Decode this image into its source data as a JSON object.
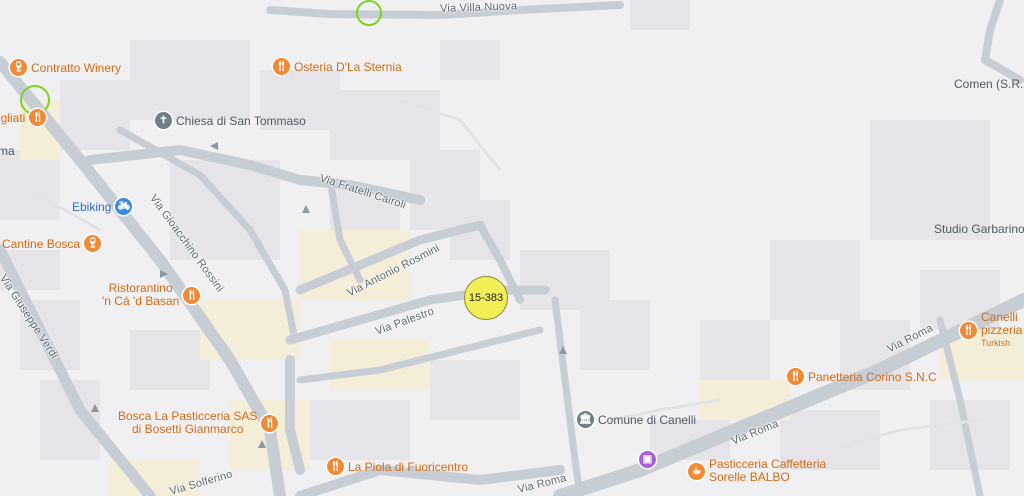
{
  "map": {
    "marker": {
      "label": "15-383"
    },
    "streets": {
      "via_villa_nuova": "Via Villa Nuova",
      "via_fratelli_cairoli": "Via Fratelli Cairoli",
      "via_gioacchino_rossini": "Via Gioacchino Rossini",
      "via_antonio_rosmini": "Via Antonio Rosmini",
      "via_palestro": "Via Palestro",
      "via_giuseppe_verdi": "Via Giuseppe Verdi",
      "via_roma_east": "Via Roma",
      "via_roma_center": "Via Roma",
      "via_roma_south": "Via Roma",
      "via_solferino": "Via Solferino"
    },
    "pois": {
      "contratto": "Contratto Winery",
      "osteria": "Osteria D'La Sternia",
      "chiesa": "Chiesa di San Tommaso",
      "figliati": "igliati",
      "ebiking": "Ebiking",
      "cantine_bosca": "Cantine Bosca",
      "ristorantino_1": "Ristorantino",
      "ristorantino_2": "'n Cá 'd Basan",
      "bosca_pasticceria_1": "Bosca La Pasticceria SAS",
      "bosca_pasticceria_2": "di Bosetti Gianmarco",
      "piola": "La Piola di Fuoricentro",
      "comune": "Comune di Canelli",
      "panetteria": "Panetteria Corino S.N.C",
      "pasticceria_1": "Pasticceria Caffetteria",
      "pasticceria_2": "Sorelle BALBO",
      "canelli_pizzeria_1": "Canelli",
      "canelli_pizzeria_2": "pizzeria",
      "canelli_pizzeria_3": "Turkish",
      "studio_garbarino": "Studio Garbarino",
      "comen": "Comen (S.R.L",
      "left_cut_ma": "ma"
    }
  }
}
